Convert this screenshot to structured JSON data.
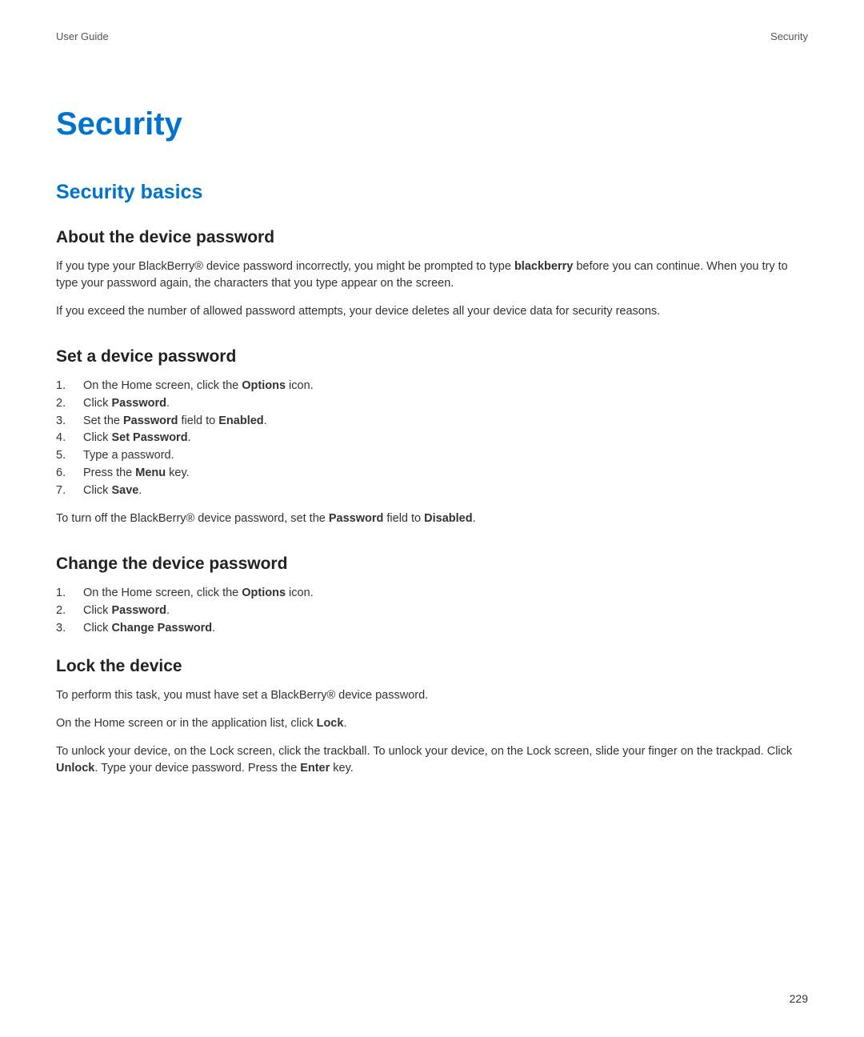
{
  "header": {
    "left": "User Guide",
    "right": "Security"
  },
  "title": "Security",
  "section_title": "Security basics",
  "about": {
    "heading": "About the device password",
    "p1_a": "If you type your BlackBerry® device password incorrectly, you might be prompted to type ",
    "p1_bold": "blackberry",
    "p1_b": " before you can continue. When you try to type your password again, the characters that you type appear on the screen.",
    "p2": "If you exceed the number of allowed password attempts, your device deletes all your device data for security reasons."
  },
  "set": {
    "heading": "Set a device password",
    "items": {
      "i1_a": "On the Home screen, click the ",
      "i1_bold": "Options",
      "i1_b": " icon.",
      "i2_a": "Click ",
      "i2_bold": "Password",
      "i2_b": ".",
      "i3_a": "Set the ",
      "i3_bold1": "Password",
      "i3_b": " field to ",
      "i3_bold2": "Enabled",
      "i3_c": ".",
      "i4_a": "Click ",
      "i4_bold": "Set Password",
      "i4_b": ".",
      "i5": "Type a password.",
      "i6_a": "Press the ",
      "i6_bold": "Menu",
      "i6_b": " key.",
      "i7_a": "Click ",
      "i7_bold": "Save",
      "i7_b": "."
    },
    "note_a": "To turn off the BlackBerry® device password, set the ",
    "note_bold1": "Password",
    "note_b": " field to ",
    "note_bold2": "Disabled",
    "note_c": "."
  },
  "change": {
    "heading": "Change the device password",
    "items": {
      "i1_a": "On the Home screen, click the ",
      "i1_bold": "Options",
      "i1_b": " icon.",
      "i2_a": "Click ",
      "i2_bold": "Password",
      "i2_b": ".",
      "i3_a": "Click ",
      "i3_bold": "Change Password",
      "i3_b": "."
    }
  },
  "lock": {
    "heading": "Lock the device",
    "p1": "To perform this task, you must have set a BlackBerry® device password.",
    "p2_a": "On the Home screen or in the application list, click ",
    "p2_bold": "Lock",
    "p2_b": ".",
    "p3_a": "To unlock your device, on the Lock screen, click the trackball. To unlock your device, on the Lock screen, slide your finger on the trackpad. Click ",
    "p3_bold1": "Unlock",
    "p3_b": ". Type your device password. Press the ",
    "p3_bold2": "Enter",
    "p3_c": " key."
  },
  "page_number": "229"
}
